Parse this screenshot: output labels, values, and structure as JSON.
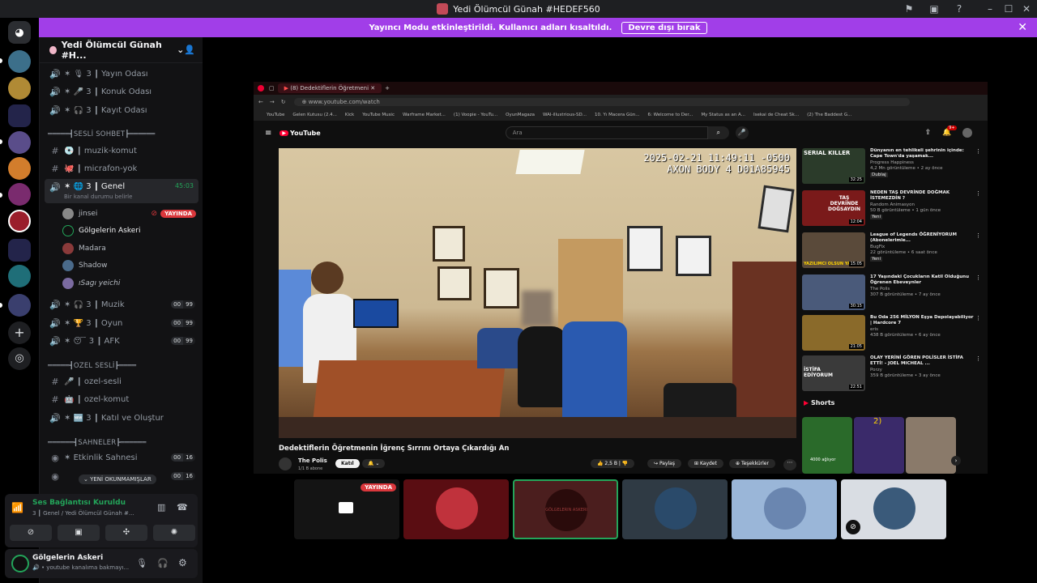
{
  "window": {
    "title": "Yedi Ölümcül Günah #HEDEF560"
  },
  "banner": {
    "text": "Yayıncı Modu etkinleştirildi. Kullanıcı adları kısaltıldı.",
    "button": "Devre dışı bırak"
  },
  "server": {
    "name": "Yedi Ölümcül Günah #H..."
  },
  "channels": {
    "yayin": "3 ┃ Yayın Odası",
    "konuk": "3 ┃ Konuk Odası",
    "kayit": "3 ┃ Kayıt Odası",
    "cat_sesli": "═════┫SESLİ SOHBET┣══════",
    "muzik_komut": "┃ muzik-komut",
    "mikrofon": "┃ micrafon-yok",
    "genel": "3 ┃ Genel",
    "genel_timer": "45:03",
    "genel_status": "Bir kanal durumu belirle",
    "muzik": "3 ┃ Muzik",
    "oyun": "3 ┃ Oyun",
    "afk": "3 ┃ AFK",
    "cat_ozel": "═════┫OZEL SESLİ┣════",
    "ozel_sesli": "┃ ozel-sesli",
    "ozel_komut": "┃ ozel-komut",
    "katil": "3 ┃ Katıl ve Oluştur",
    "cat_sahne": "══════┫SAHNELER┣══════",
    "etkinlik": "Etkinlik Sahnesi",
    "unread": "YENİ OKUNMAMIŞLAR",
    "count_a": "00",
    "count_b": "99",
    "count_c": "16"
  },
  "users": [
    {
      "name": "jinsei",
      "live": "YAYINDA"
    },
    {
      "name": "Gölgelerin Askeri"
    },
    {
      "name": "Madara"
    },
    {
      "name": "Shadow"
    },
    {
      "name": "ıSagı yeichi"
    }
  ],
  "voice": {
    "status": "Ses Bağlantısı Kuruldu",
    "channel": "3 ┃ Genel / Yedi Ölümcül Günah #..."
  },
  "me": {
    "name": "Gölgelerin Askeri",
    "status": "youtube kanalıma bakmayı..."
  },
  "browser": {
    "tab": "(8) Dedektiflerin Öğretmeni",
    "url": "www.youtube.com/watch",
    "bookmarks": [
      "YouTube",
      "Gelen Kutusu (2.4...",
      "Kick",
      "YouTube Music",
      "Warframe Market...",
      "(1) Voopie - YouTu...",
      "OyunMagaza",
      "WAI-illustrious-SD...",
      "10. Yı Macera Gün...",
      "6: Welcome to Der...",
      "My Status as an A...",
      "Isekai de Cheat Sk...",
      "(2) The Baddest G..."
    ],
    "search_placeholder": "Ara",
    "notif_count": "9+",
    "video_timestamp": "2025-02-21 11:49:11 -0500",
    "video_device": "AXON BODY 4 D01A85945",
    "video_title": "Dedektiflerin Öğretmenin İğrenç Sırrını Ortaya Çıkardığı An",
    "channel": "The Polis",
    "subs": "1/1 B abone",
    "join": "Katıl",
    "likes": "2,5 B",
    "share": "Paylaş",
    "save": "Kaydet",
    "thanks": "Teşekkürler",
    "shorts": "Shorts",
    "shorts_overlay": "4000 ağlıyor",
    "shorts_overlay2": "2)"
  },
  "related": [
    {
      "title": "Dünyanın en tehlikeli şehrinin içinde: Cape Town'da yaşamak...",
      "channel": "Progress Happiness",
      "meta": "4,2 Mn görüntüleme • 2 ay önce",
      "dur": "32:25",
      "tag": "Dublaj",
      "thumb_text": "SERIAL KILLER"
    },
    {
      "title": "NEDEN TAŞ DEVRİNDE DOĞMAK İSTEMEZDİN ?",
      "channel": "Random Animasyon",
      "meta": "50 B görüntüleme • 1 gün önce",
      "dur": "12:04",
      "tag": "Yeni",
      "thumb_text": "TAŞ DEVRİNDE DOĞSAYDIN"
    },
    {
      "title": "League of Legends ÖĞRENİYORUM (Abonelerimle...",
      "channel": "BugFix",
      "meta": "22 görüntüleme • 6 saat önce",
      "dur": "15:05",
      "tag": "Yeni",
      "thumb_text": "YAZILIMCI OLSUN YAS"
    },
    {
      "title": "17 Yaşındaki Çocukların Katil Olduğunu Öğrenen Ebeveynler",
      "channel": "The Polis",
      "meta": "307 B görüntüleme • 7 ay önce",
      "dur": "30:15",
      "tag": "",
      "thumb_text": ""
    },
    {
      "title": "Bu Oda 256 MİLYON Eşya Depolayabiliyor | Hardcore 7",
      "channel": "eris",
      "meta": "438 B görüntüleme • 6 ay önce",
      "dur": "21:05",
      "tag": "",
      "thumb_text": ""
    },
    {
      "title": "OLAY YERİNİ GÖREN POLİSLER İSTİFA ETTİ! - JOEL MICHEAL ...",
      "channel": "Porzy",
      "meta": "359 B görüntüleme • 3 ay önce",
      "dur": "22:51",
      "tag": "",
      "thumb_text": "İSTİFA EDİYORUM"
    }
  ],
  "tiles": {
    "live": "YAYINDA",
    "askeri": "GÖLGELERIN ASKERI"
  },
  "colors": {
    "brand": "#a13ee8",
    "live": "#da373c",
    "connected": "#23a55a",
    "yt_red": "#ff0033"
  }
}
